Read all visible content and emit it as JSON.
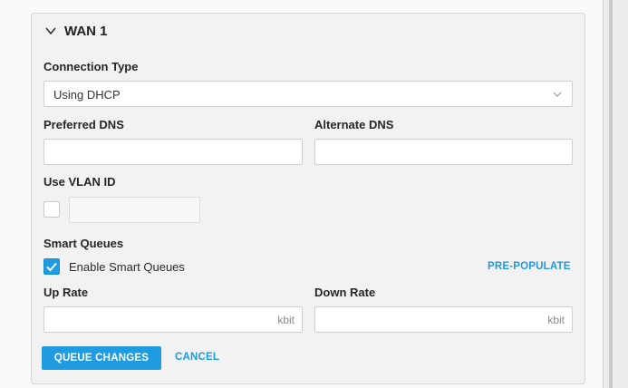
{
  "section": {
    "title": "WAN 1",
    "collapse_icon": "chevron-down-icon"
  },
  "connection_type": {
    "label": "Connection Type",
    "value": "Using DHCP",
    "options_visible": [
      "Using DHCP"
    ]
  },
  "preferred_dns": {
    "label": "Preferred DNS",
    "value": ""
  },
  "alternate_dns": {
    "label": "Alternate DNS",
    "value": ""
  },
  "vlan": {
    "label": "Use VLAN ID",
    "checked": false,
    "value": ""
  },
  "smart_queues": {
    "label": "Smart Queues",
    "enable_label": "Enable Smart Queues",
    "enabled": true,
    "prepopulate_label": "PRE-POPULATE"
  },
  "up_rate": {
    "label": "Up Rate",
    "value": "",
    "unit": "kbit"
  },
  "down_rate": {
    "label": "Down Rate",
    "value": "",
    "unit": "kbit"
  },
  "actions": {
    "queue_changes_label": "QUEUE CHANGES",
    "cancel_label": "CANCEL"
  },
  "colors": {
    "accent": "#1f9be0",
    "panel_bg": "#f2f2f2",
    "input_border": "#cfcfcf"
  }
}
